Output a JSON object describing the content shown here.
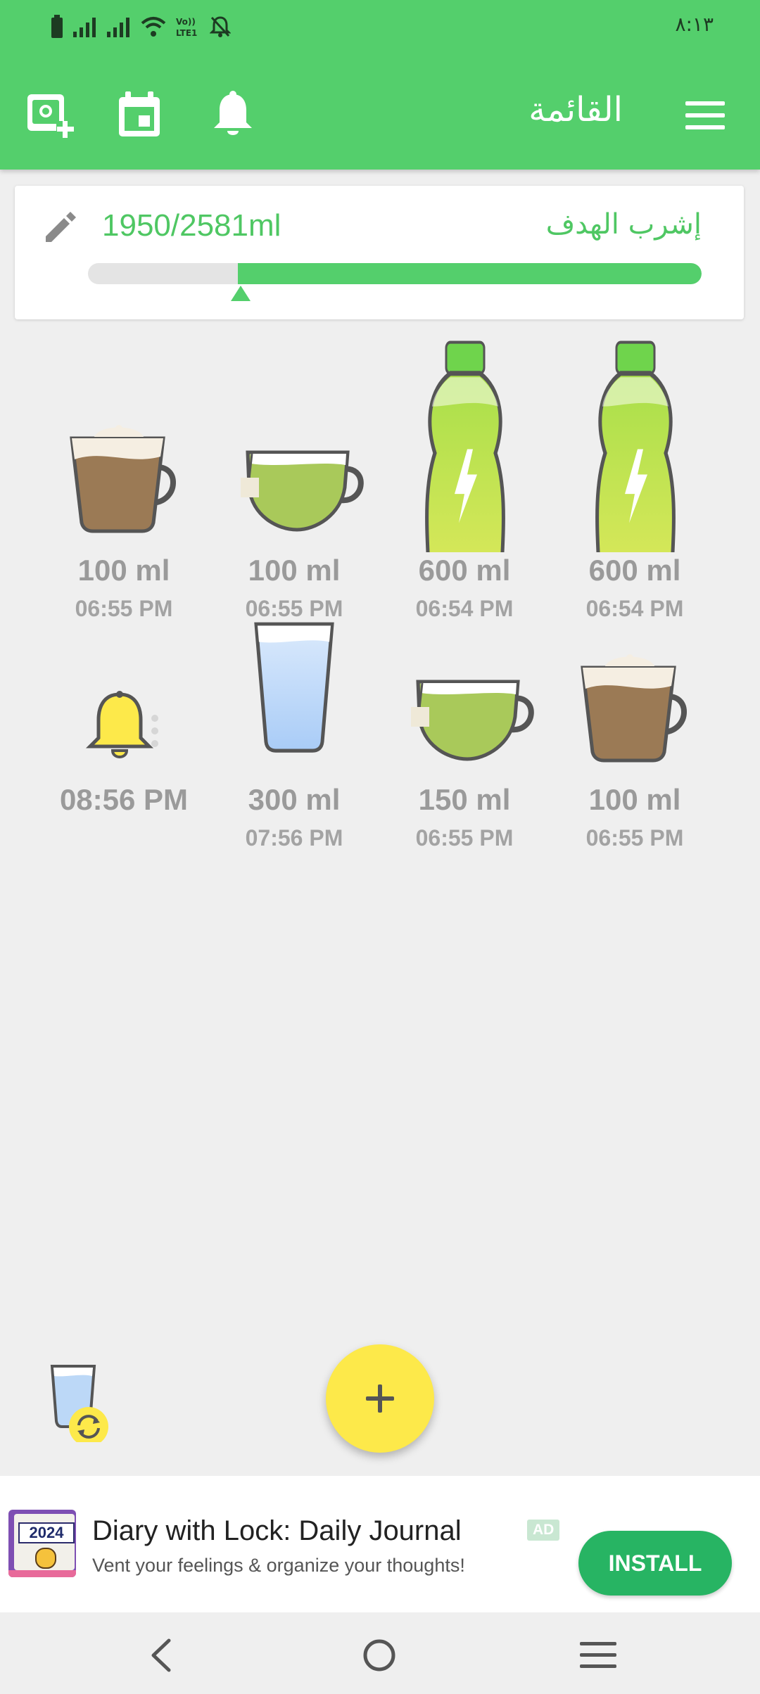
{
  "status_bar": {
    "time": "٨:١٣",
    "icons": [
      "battery-icon",
      "signal-icon",
      "signal-icon",
      "wifi-icon",
      "volte-icon",
      "notifications-off-icon"
    ]
  },
  "toolbar": {
    "title": "القائمة",
    "icons": [
      "add-photo-icon",
      "calendar-icon",
      "bell-icon",
      "menu-icon"
    ]
  },
  "goal": {
    "label": "إشرب الهدف",
    "value": "1950/2581ml",
    "progress": 0.7555,
    "accent": "#54cf6c"
  },
  "drinks": [
    {
      "icon": "coffee-cup-icon",
      "amount": "100 ml",
      "time": "06:55 PM"
    },
    {
      "icon": "tea-cup-icon",
      "amount": "100 ml",
      "time": "06:55 PM"
    },
    {
      "icon": "energy-drink-bottle-icon",
      "amount": "600 ml",
      "time": "06:54 PM"
    },
    {
      "icon": "energy-drink-bottle-icon",
      "amount": "600 ml",
      "time": "06:54 PM"
    },
    {
      "icon": "water-glass-icon",
      "amount": "300 ml",
      "time": "07:56 PM"
    },
    {
      "icon": "tea-cup-icon",
      "amount": "150 ml",
      "time": "06:55 PM"
    },
    {
      "icon": "coffee-cup-icon",
      "amount": "100 ml",
      "time": "06:55 PM"
    }
  ],
  "reminder": {
    "icon": "bell-icon",
    "time": "08:56 PM"
  },
  "fab": {
    "label": "+",
    "color": "#fde94a"
  },
  "ad": {
    "icon_text": "2024",
    "title": "Diary with Lock: Daily Journal",
    "subtitle": "Vent your feelings & organize your thoughts!",
    "badge": "AD",
    "button": "INSTALL"
  },
  "nav": {
    "icons": [
      "back-icon",
      "home-icon",
      "recents-icon"
    ]
  }
}
